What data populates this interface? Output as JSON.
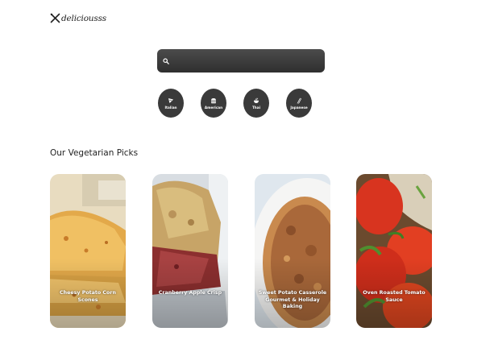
{
  "brand": {
    "name": "deliciousss"
  },
  "search": {
    "value": "",
    "placeholder": ""
  },
  "cuisines": [
    {
      "label": "Italian",
      "icon": "pizza-icon"
    },
    {
      "label": "American",
      "icon": "burger-icon"
    },
    {
      "label": "Thai",
      "icon": "noodle-bowl-icon"
    },
    {
      "label": "Japanese",
      "icon": "chopsticks-icon"
    }
  ],
  "section": {
    "title": "Our Vegetarian Picks"
  },
  "recipes": [
    {
      "title": "Cheesy Potato Corn Scones"
    },
    {
      "title": "Cranberry Apple Crisp"
    },
    {
      "title": "Sweet Potato Casserole Gourmet & Holiday Baking"
    },
    {
      "title": "Oven Roasted Tomato Sauce"
    }
  ],
  "colors": {
    "button_dark": "#3a3a3a",
    "search_bg": "#3d3d3d",
    "text": "#222222"
  }
}
